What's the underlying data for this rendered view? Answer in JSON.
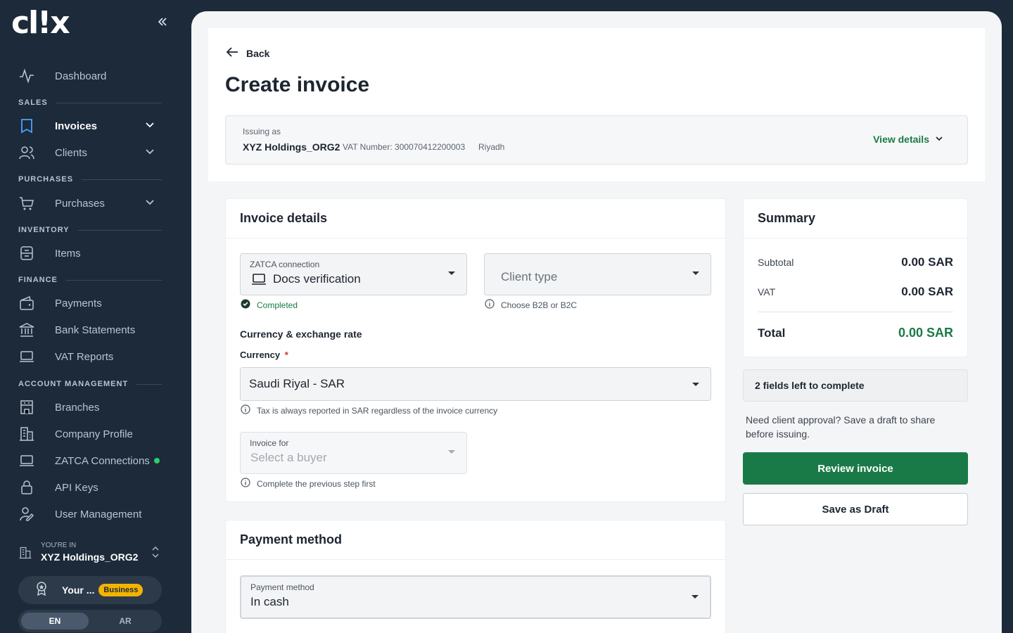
{
  "app": {
    "logo_text": "cl!x"
  },
  "sidebar": {
    "dashboard": "Dashboard",
    "sections": {
      "sales": "SALES",
      "purchases": "PURCHASES",
      "inventory": "INVENTORY",
      "finance": "FINANCE",
      "account": "ACCOUNT MANAGEMENT"
    },
    "items": {
      "invoices": "Invoices",
      "clients": "Clients",
      "purchases": "Purchases",
      "items": "Items",
      "payments": "Payments",
      "bank_statements": "Bank Statements",
      "vat_reports": "VAT Reports",
      "branches": "Branches",
      "company_profile": "Company Profile",
      "zatca_connections": "ZATCA Connections",
      "api_keys": "API Keys",
      "user_management": "User Management"
    },
    "org": {
      "caption": "YOU'RE IN",
      "name": "XYZ Holdings_ORG2"
    },
    "plan": {
      "text": "Your ...",
      "badge": "Business"
    },
    "lang": {
      "en": "EN",
      "ar": "AR"
    }
  },
  "header": {
    "back_label": "Back",
    "title": "Create invoice",
    "issuing": {
      "caption": "Issuing as",
      "org": "XYZ Holdings_ORG2",
      "vat": "VAT Number: 300070412200003",
      "city": "Riyadh",
      "view_details": "View details"
    }
  },
  "invoice_details": {
    "title": "Invoice details",
    "zatca": {
      "label": "ZATCA connection",
      "value": "Docs verification",
      "status": "Completed"
    },
    "client_type": {
      "placeholder": "Client type",
      "help": "Choose B2B or B2C"
    },
    "currency_section": "Currency & exchange rate",
    "currency": {
      "label": "Currency",
      "required": "*",
      "value": "Saudi Riyal - SAR",
      "help": "Tax is always reported in SAR regardless of the invoice currency"
    },
    "invoice_for": {
      "label": "Invoice for",
      "placeholder": "Select a buyer",
      "help": "Complete the previous step first"
    }
  },
  "payment": {
    "title": "Payment method",
    "field": {
      "label": "Payment method",
      "value": "In cash"
    }
  },
  "summary": {
    "title": "Summary",
    "subtotal_label": "Subtotal",
    "subtotal": "0.00 SAR",
    "vat_label": "VAT",
    "vat": "0.00 SAR",
    "total_label": "Total",
    "total": "0.00 SAR",
    "fields_left": "2 fields left to complete",
    "note": "Need client approval? Save a draft to share before issuing.",
    "review_btn": "Review invoice",
    "draft_btn": "Save as Draft"
  },
  "colors": {
    "brand_green": "#1a7a47",
    "sidebar_bg": "#1c2a3a",
    "badge": "#f5b301",
    "status_dot": "#2ecc71"
  }
}
